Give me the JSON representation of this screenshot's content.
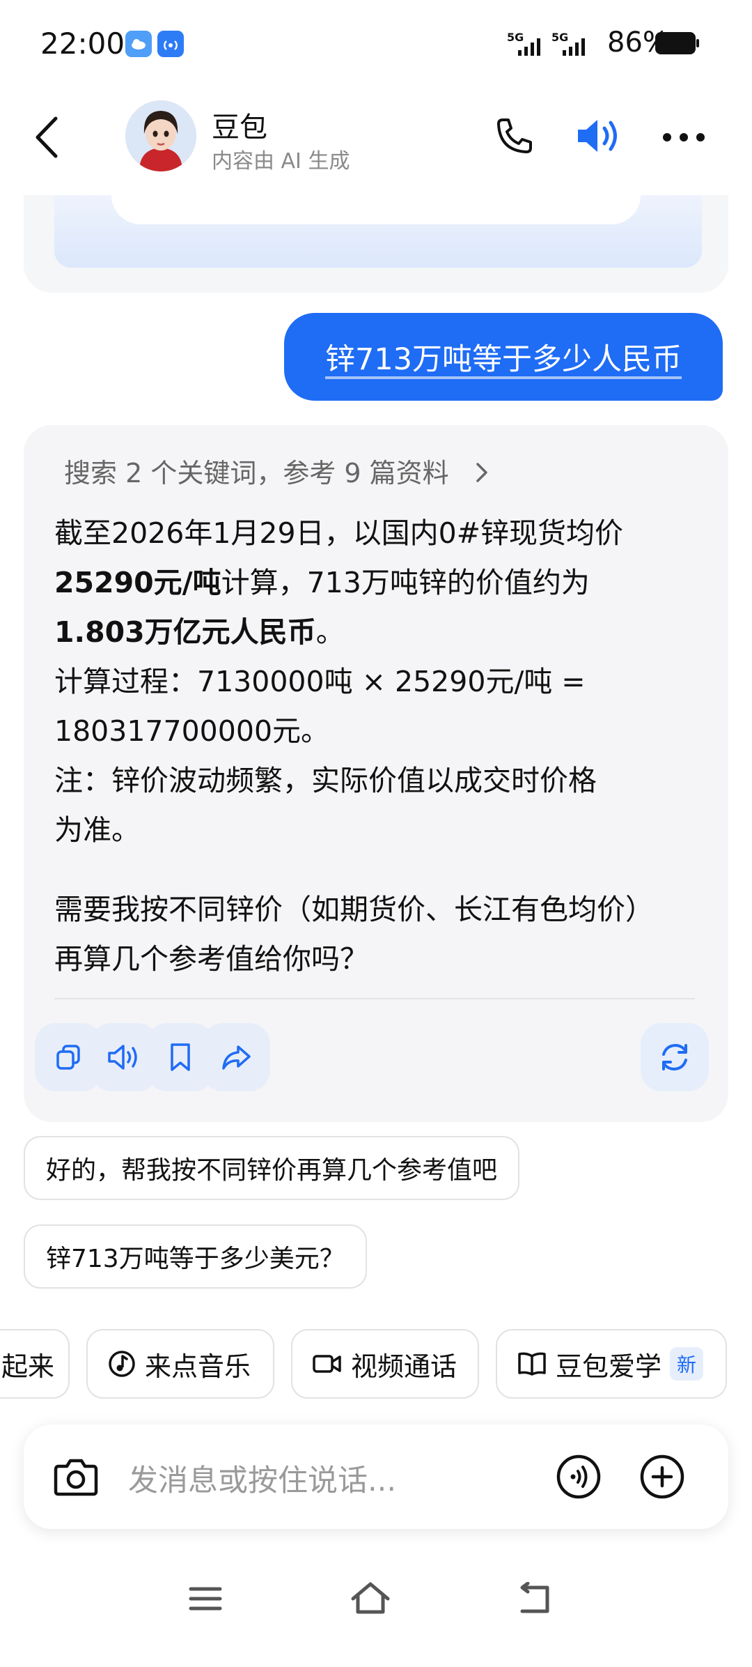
{
  "status_bar": {
    "time": "22:00",
    "signal1_label": "5G",
    "signal2_label": "5G",
    "battery_percent": "86%"
  },
  "header": {
    "title": "豆包",
    "subtitle": "内容由 AI 生成"
  },
  "user_message": "锌713万吨等于多少人民币",
  "answer": {
    "search_summary": "搜索 2 个关键词，参考 9 篇资料",
    "line1": "截至2026年1月29日，以国内0#锌现货均价",
    "line2_bold": "25290元/吨",
    "line2_rest": "计算，713万吨锌的价值约为",
    "line3_bold": "1.803万亿元人民币",
    "line3_rest": "。",
    "line4": "计算过程：7130000吨 × 25290元/吨 =",
    "line5": "180317700000元。",
    "line6": "注：锌价波动频繁，实际价值以成交时价格",
    "line7": "为准。",
    "followup_line1": "需要我按不同锌价（如期货价、长江有色均价）",
    "followup_line2": "再算几个参考值给你吗？"
  },
  "suggestions": [
    "好的，帮我按不同锌价再算几个参考值吧",
    "锌713万吨等于多少美元？"
  ],
  "quick_chips": [
    {
      "label": "起来"
    },
    {
      "label": "来点音乐"
    },
    {
      "label": "视频通话"
    },
    {
      "label": "豆包爱学",
      "badge": "新"
    }
  ],
  "input": {
    "placeholder": "发消息或按住说话..."
  },
  "colors": {
    "accent": "#1f6cf5",
    "card_bg": "#f5f5f7"
  }
}
